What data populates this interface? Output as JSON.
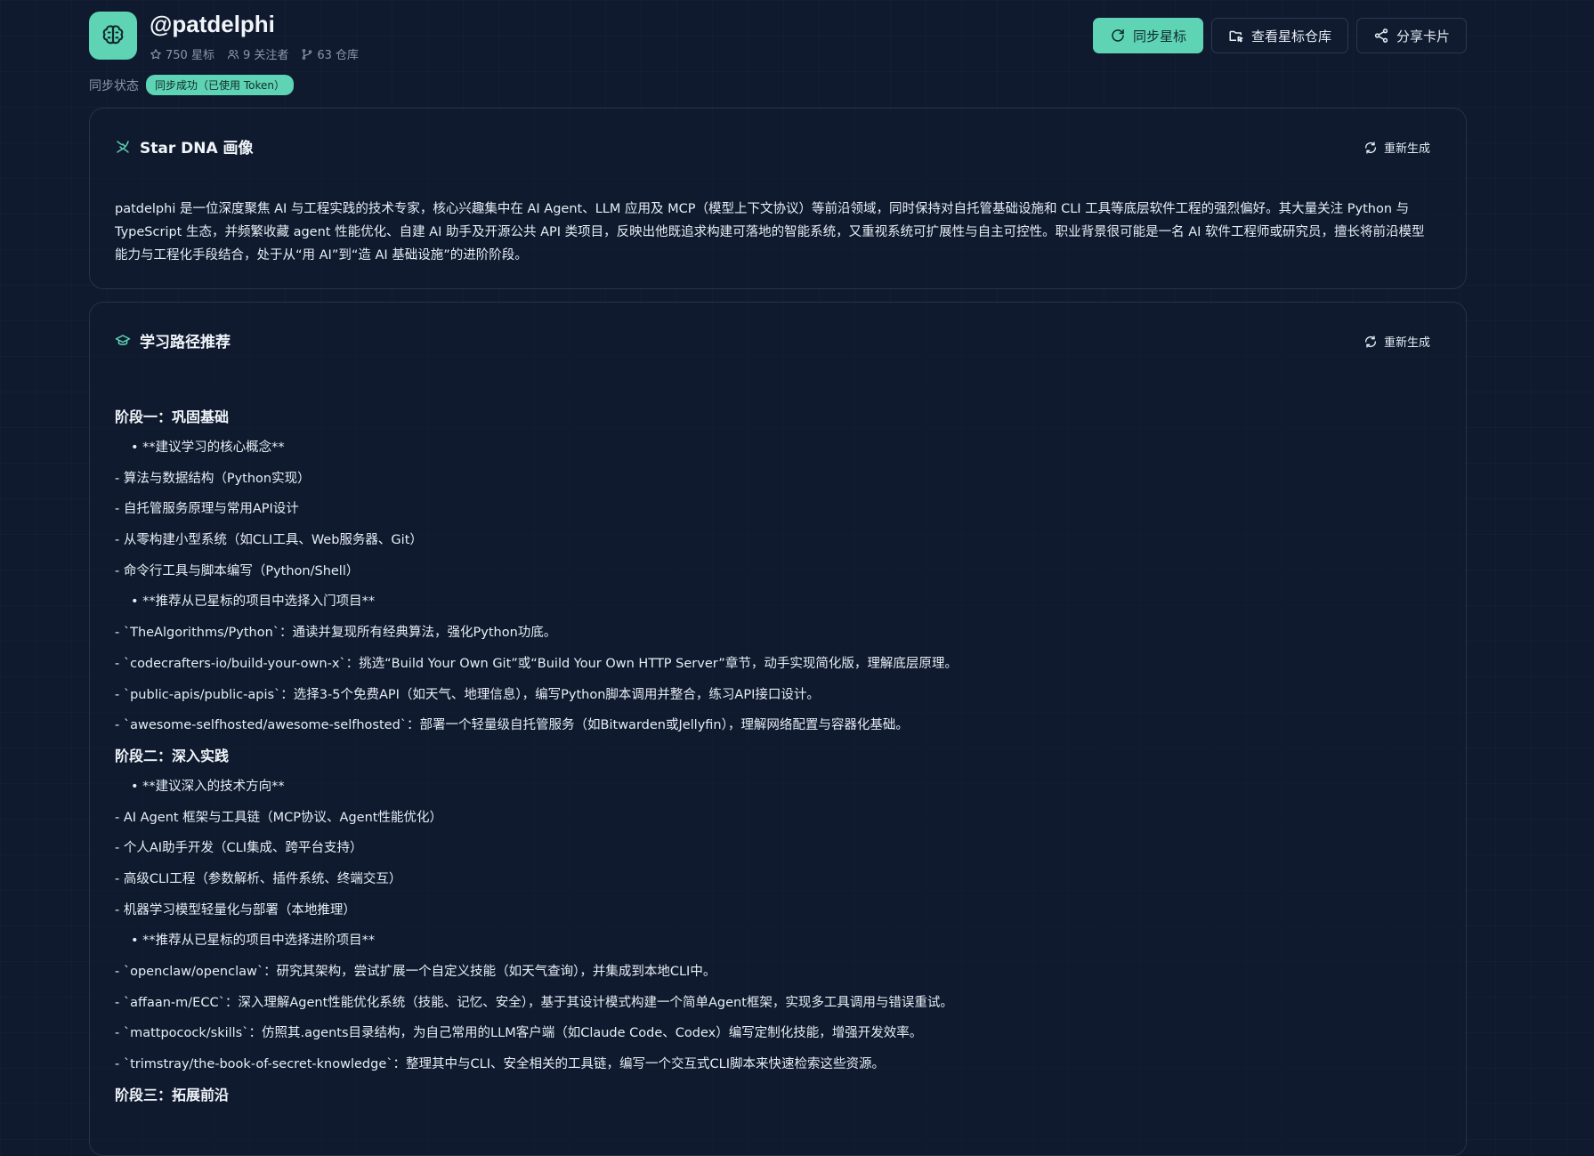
{
  "profile": {
    "username": "@patdelphi",
    "stars": "750 星标",
    "followers": "9 关注者",
    "repos": "63 仓库",
    "sync_label": "同步状态",
    "sync_status": "同步成功（已使用 Token）"
  },
  "actions": {
    "sync_stars": "同步星标",
    "view_repos": "查看星标仓库",
    "share_card": "分享卡片"
  },
  "dna": {
    "title": "Star DNA 画像",
    "regenerate": "重新生成",
    "text": "patdelphi 是一位深度聚焦 AI 与工程实践的技术专家，核心兴趣集中在 AI Agent、LLM 应用及 MCP（模型上下文协议）等前沿领域，同时保持对自托管基础设施和 CLI 工具等底层软件工程的强烈偏好。其大量关注 Python 与 TypeScript 生态，并频繁收藏 agent 性能优化、自建 AI 助手及开源公共 API 类项目，反映出他既追求构建可落地的智能系统，又重视系统可扩展性与自主可控性。职业背景很可能是一名 AI 软件工程师或研究员，擅长将前沿模型能力与工程化手段结合，处于从“用 AI”到“造 AI 基础设施”的进阶阶段。"
  },
  "learning": {
    "title": "学习路径推荐",
    "regenerate": "重新生成",
    "stage1": {
      "title": "阶段一：巩固基础",
      "b1": "• **建议学习的核心概念**",
      "l1": "- 算法与数据结构（Python实现）",
      "l2": "- 自托管服务原理与常用API设计",
      "l3": "- 从零构建小型系统（如CLI工具、Web服务器、Git）",
      "l4": "- 命令行工具与脚本编写（Python/Shell）",
      "b2": "• **推荐从已星标的项目中选择入门项目**",
      "l5": "- `TheAlgorithms/Python`：通读并复现所有经典算法，强化Python功底。",
      "l6": "- `codecrafters-io/build-your-own-x`：挑选“Build Your Own Git”或“Build Your Own HTTP Server”章节，动手实现简化版，理解底层原理。",
      "l7": "- `public-apis/public-apis`：选择3-5个免费API（如天气、地理信息），编写Python脚本调用并整合，练习API接口设计。",
      "l8": "- `awesome-selfhosted/awesome-selfhosted`：部署一个轻量级自托管服务（如Bitwarden或Jellyfin），理解网络配置与容器化基础。"
    },
    "stage2": {
      "title": "阶段二：深入实践",
      "b1": "• **建议深入的技术方向**",
      "l1": "- AI Agent 框架与工具链（MCP协议、Agent性能优化）",
      "l2": "- 个人AI助手开发（CLI集成、跨平台支持）",
      "l3": "- 高级CLI工程（参数解析、插件系统、终端交互）",
      "l4": "- 机器学习模型轻量化与部署（本地推理）",
      "b2": "• **推荐从已星标的项目中选择进阶项目**",
      "l5": "- `openclaw/openclaw`：研究其架构，尝试扩展一个自定义技能（如天气查询），并集成到本地CLI中。",
      "l6": "- `affaan-m/ECC`：深入理解Agent性能优化系统（技能、记忆、安全），基于其设计模式构建一个简单Agent框架，实现多工具调用与错误重试。",
      "l7": "- `mattpocock/skills`：仿照其.agents目录结构，为自己常用的LLM客户端（如Claude Code、Codex）编写定制化技能，增强开发效率。",
      "l8": "- `trimstray/the-book-of-secret-knowledge`：整理其中与CLI、安全相关的工具链，编写一个交互式CLI脚本来快速检索这些资源。"
    },
    "stage3": {
      "title": "阶段三：拓展前沿"
    }
  },
  "colors": {
    "accent": "#5fd4b5",
    "background": "#0f1a2e",
    "border": "#25324a"
  }
}
